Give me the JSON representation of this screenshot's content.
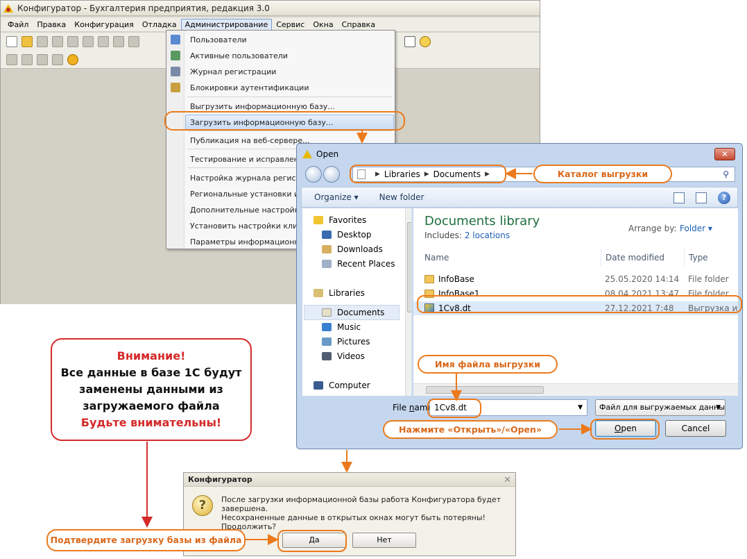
{
  "configurator": {
    "title": "Конфигуратор - Бухгалтерия предприятия, редакция 3.0",
    "menu": [
      "Файл",
      "Правка",
      "Конфигурация",
      "Отладка",
      "Администрирование",
      "Сервис",
      "Окна",
      "Справка"
    ],
    "admin_menu": [
      "Пользователи",
      "Активные пользователи",
      "Журнал регистрации",
      "Блокировки аутентификации",
      "Выгрузить информационную базу...",
      "Загрузить информационную базу...",
      "Публикация на веб-сервере...",
      "Тестирование и исправление...",
      "Настройка журнала регистрац",
      "Региональные установки инфо",
      "Дополнительные настройки ад",
      "Установить настройки клиент",
      "Параметры информационной"
    ]
  },
  "open_dialog": {
    "title": "Open",
    "close": "✕",
    "breadcrumb": [
      "Libraries",
      "Documents"
    ],
    "toolbar": {
      "organize": "Organize ▾",
      "new_folder": "New folder"
    },
    "nav_tree": [
      {
        "label": "Favorites",
        "icon": "star-icon"
      },
      {
        "label": "Desktop",
        "icon": "desktop-icon"
      },
      {
        "label": "Downloads",
        "icon": "downloads-icon"
      },
      {
        "label": "Recent Places",
        "icon": "recent-places-icon"
      },
      {
        "label": "Libraries",
        "icon": "libraries-icon"
      },
      {
        "label": "Documents",
        "icon": "documents-icon"
      },
      {
        "label": "Music",
        "icon": "music-icon"
      },
      {
        "label": "Pictures",
        "icon": "pictures-icon"
      },
      {
        "label": "Videos",
        "icon": "videos-icon"
      },
      {
        "label": "Computer",
        "icon": "computer-icon"
      }
    ],
    "library_title": "Documents library",
    "includes_label": "Includes:",
    "includes_link": "2 locations",
    "arrange_by_label": "Arrange by:",
    "arrange_by_value": "Folder ▾",
    "columns": [
      "Name",
      "Date modified",
      "Type"
    ],
    "files": [
      {
        "name": "InfoBase",
        "date": "25.05.2020 14:14",
        "type": "File folder"
      },
      {
        "name": "InfoBase1",
        "date": "08.04.2021 13:47",
        "type": "File folder"
      },
      {
        "name": "1Cv8.dt",
        "date": "27.12.2021 7:48",
        "type": "Выгрузка инф"
      }
    ],
    "file_name_label_pre": "File ",
    "file_name_label_u": "n",
    "file_name_label_post": "ame:",
    "file_name_value": "1Cv8.dt",
    "file_type": "Файл для выгружаемых данны",
    "open_pre": "",
    "open_u": "O",
    "open_post": "pen",
    "cancel": "Cancel"
  },
  "confirm_dialog": {
    "title": "Конфигуратор",
    "close": "✕",
    "message": [
      "После загрузки информационной базы работа Конфигуратора будет завершена.",
      "Несохраненные данные в открытых окнах могут быть потеряны!",
      "Продолжить?"
    ],
    "yes": "Да",
    "no": "Нет"
  },
  "annotations": {
    "catalog": "Каталог выгрузки",
    "filename": "Имя файла выгрузки",
    "press_open": "Нажмите «Открыть»/«Open»",
    "confirm": "Подтвердите загрузку базы из файла",
    "warning": {
      "line1": "Внимание!",
      "line2": "Все данные в базе 1С будут",
      "line3": "заменены данными из",
      "line4": "загружаемого файла",
      "line5": "Будьте внимательны!"
    }
  },
  "colors": {
    "accent_orange": "#ec7a1c",
    "warning_red": "#d42a2a",
    "library_green": "#1e6e3e",
    "link_blue": "#1a5fb4"
  }
}
